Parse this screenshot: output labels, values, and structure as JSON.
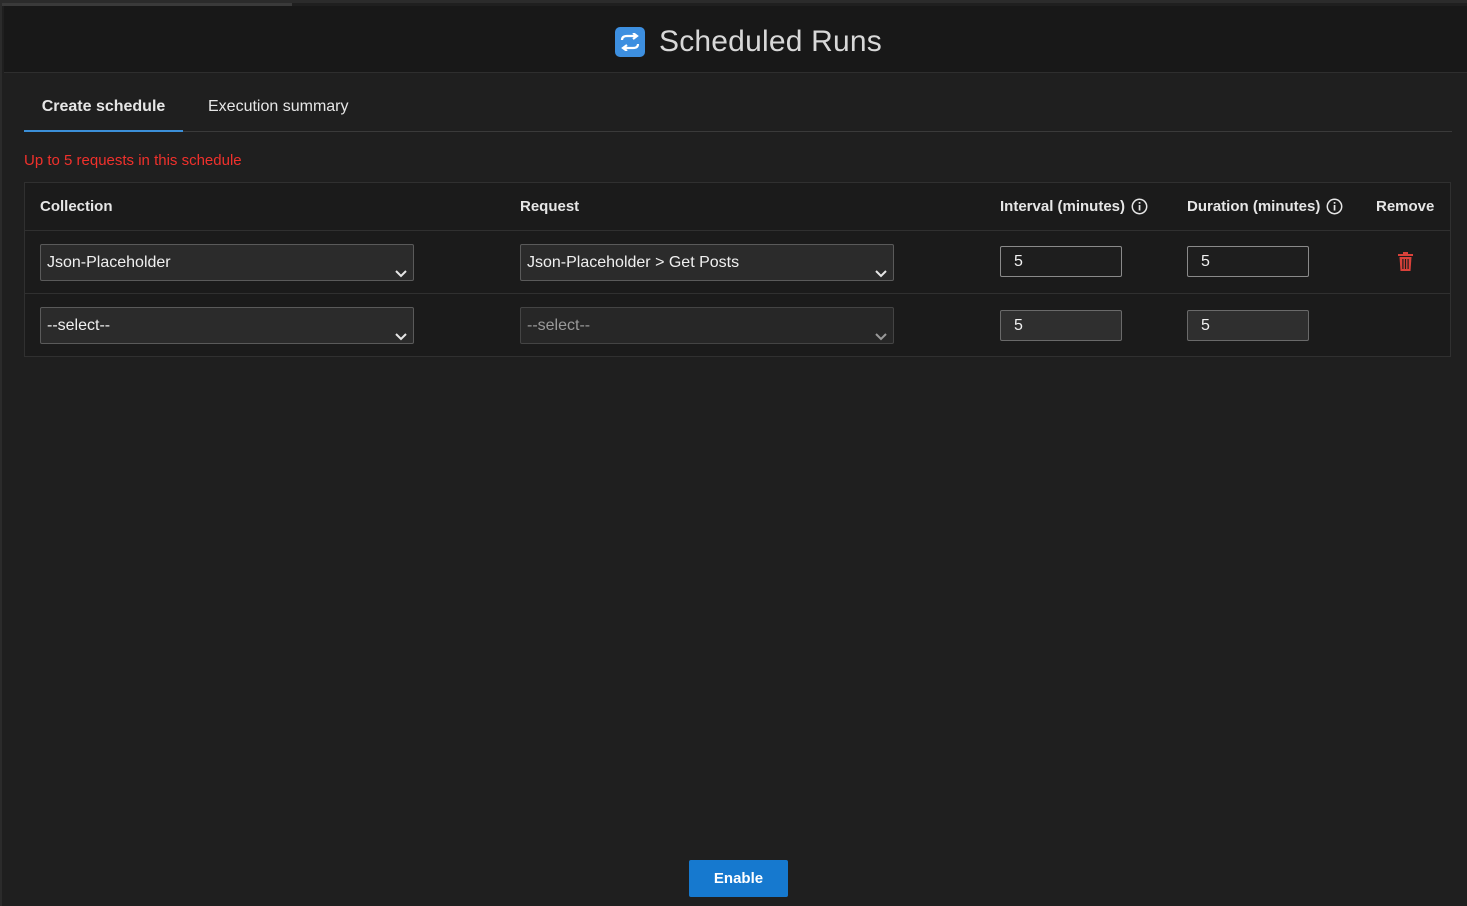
{
  "header": {
    "title": "Scheduled Runs",
    "icon": "refresh-icon",
    "icon_color": "#3d8fe0"
  },
  "tabs": [
    {
      "label": "Create schedule",
      "active": true
    },
    {
      "label": "Execution summary",
      "active": false
    }
  ],
  "limit_note": "Up to 5 requests in this schedule",
  "table": {
    "columns": {
      "collection": "Collection",
      "request": "Request",
      "interval": "Interval (minutes)",
      "duration": "Duration (minutes)",
      "remove": "Remove"
    },
    "rows": [
      {
        "collection": "Json-Placeholder",
        "request": "Json-Placeholder > Get Posts",
        "interval": "5",
        "duration": "5",
        "removable": true
      },
      {
        "collection": "--select--",
        "request": "--select--",
        "interval": "5",
        "duration": "5",
        "removable": false
      }
    ]
  },
  "enable_button": "Enable",
  "colors": {
    "accent": "#1679cf",
    "tab_underline": "#3b8fd8",
    "warning": "#f0312c",
    "delete": "#d9413a"
  }
}
